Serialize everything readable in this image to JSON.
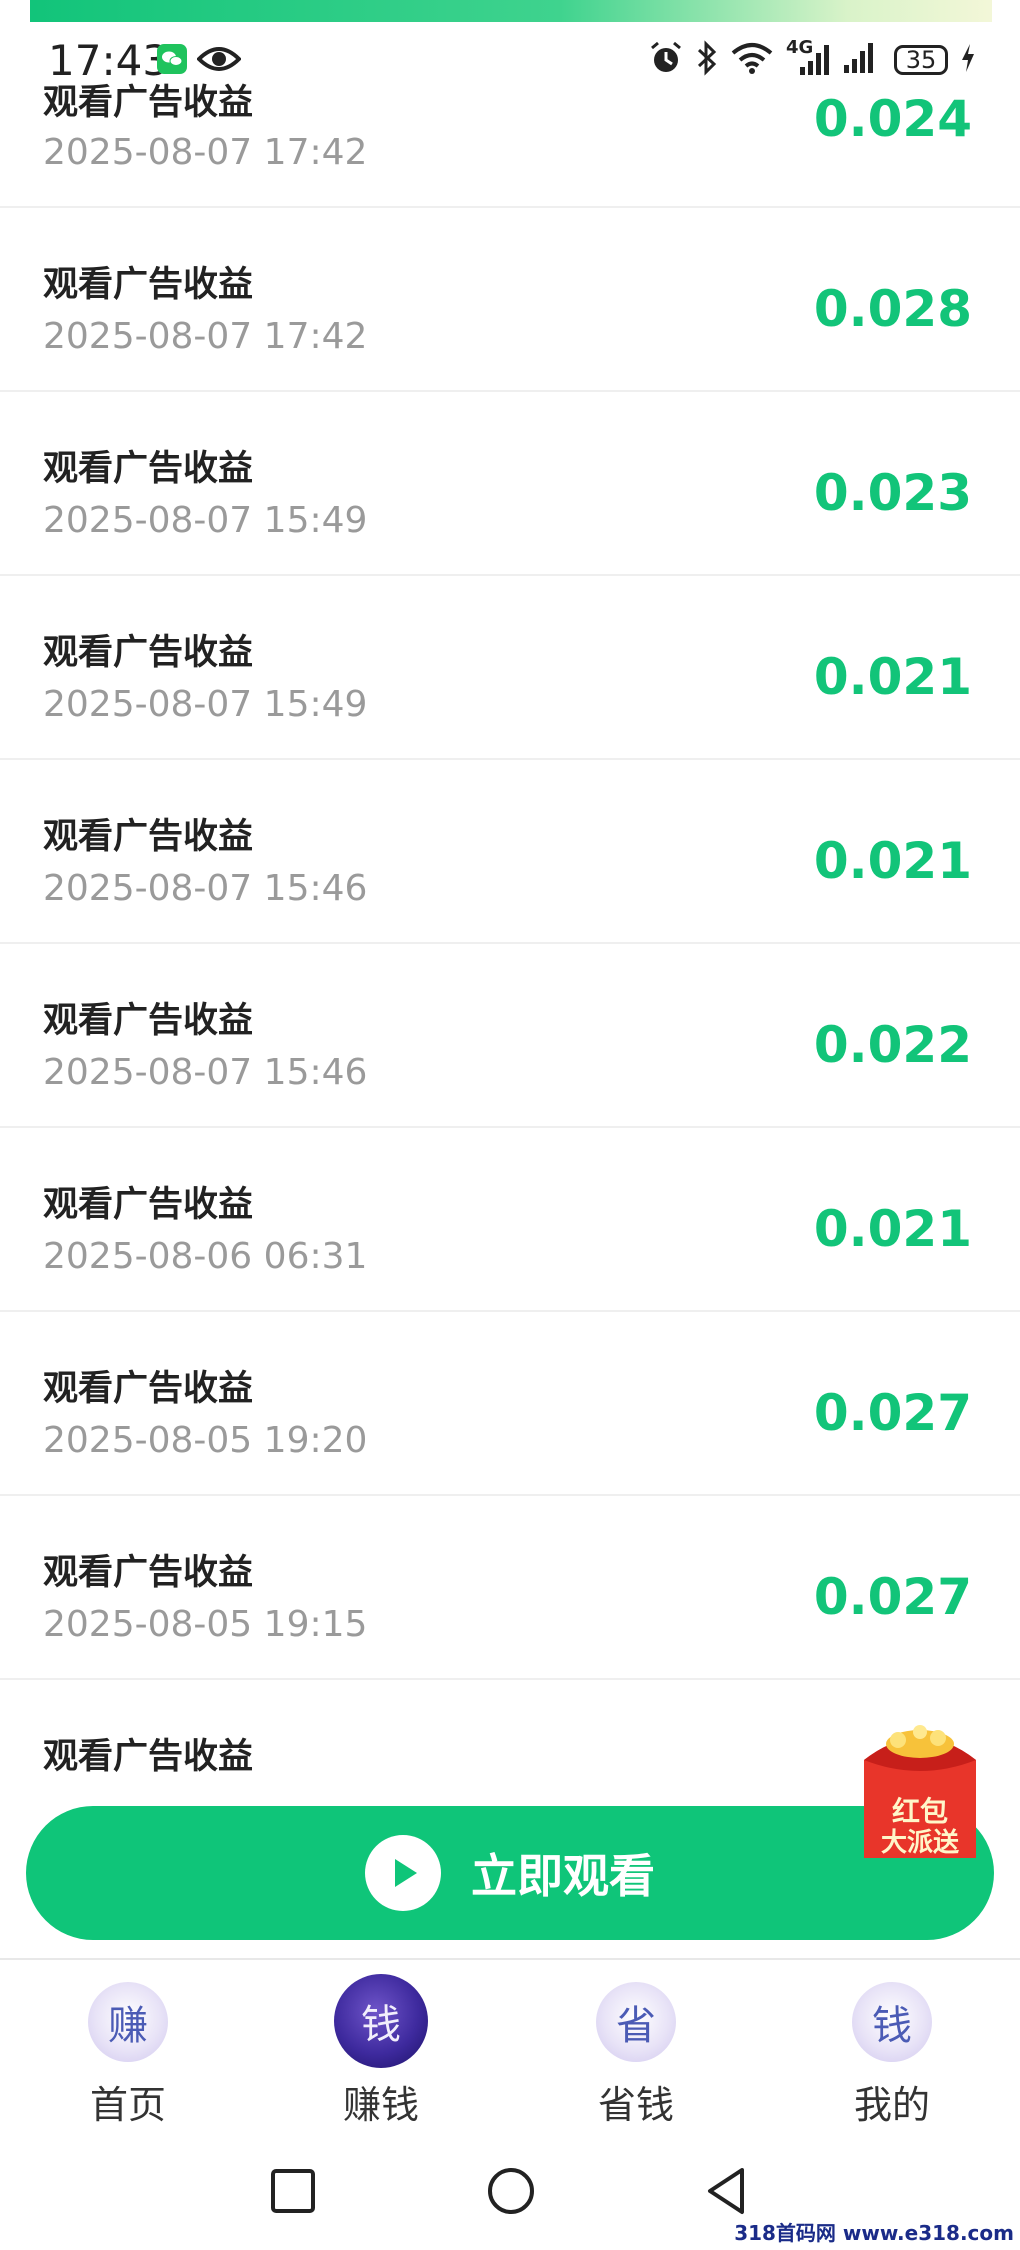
{
  "status_bar": {
    "time": "17:43",
    "network": "4G",
    "battery": "35",
    "icons": [
      "wechat-icon",
      "eye-icon",
      "alarm-icon",
      "bluetooth-icon",
      "wifi-icon",
      "signal-icon",
      "charging-icon"
    ]
  },
  "records": [
    {
      "title": "观看广告收益",
      "time": "2025-08-07 17:42",
      "amount": "0.024"
    },
    {
      "title": "观看广告收益",
      "time": "2025-08-07 17:42",
      "amount": "0.028"
    },
    {
      "title": "观看广告收益",
      "time": "2025-08-07 15:49",
      "amount": "0.023"
    },
    {
      "title": "观看广告收益",
      "time": "2025-08-07 15:49",
      "amount": "0.021"
    },
    {
      "title": "观看广告收益",
      "time": "2025-08-07 15:46",
      "amount": "0.021"
    },
    {
      "title": "观看广告收益",
      "time": "2025-08-07 15:46",
      "amount": "0.022"
    },
    {
      "title": "观看广告收益",
      "time": "2025-08-06 06:31",
      "amount": "0.021"
    },
    {
      "title": "观看广告收益",
      "time": "2025-08-05 19:20",
      "amount": "0.027"
    },
    {
      "title": "观看广告收益",
      "time": "2025-08-05 19:15",
      "amount": "0.027"
    },
    {
      "title": "观看广告收益",
      "time": "",
      "amount": ""
    }
  ],
  "watch_button": {
    "label": "立即观看"
  },
  "red_packet": {
    "line1": "红包",
    "line2": "大派送"
  },
  "bottom_nav": {
    "items": [
      {
        "glyph": "赚",
        "label": "首页"
      },
      {
        "glyph": "钱",
        "label": "赚钱",
        "active": true
      },
      {
        "glyph": "省",
        "label": "省钱"
      },
      {
        "glyph": "钱",
        "label": "我的"
      }
    ]
  },
  "watermark": "318首码网 www.e318.com",
  "colors": {
    "accent": "#12c479",
    "button": "#0fc579",
    "text": "#222222",
    "muted": "#9a9a9a"
  }
}
